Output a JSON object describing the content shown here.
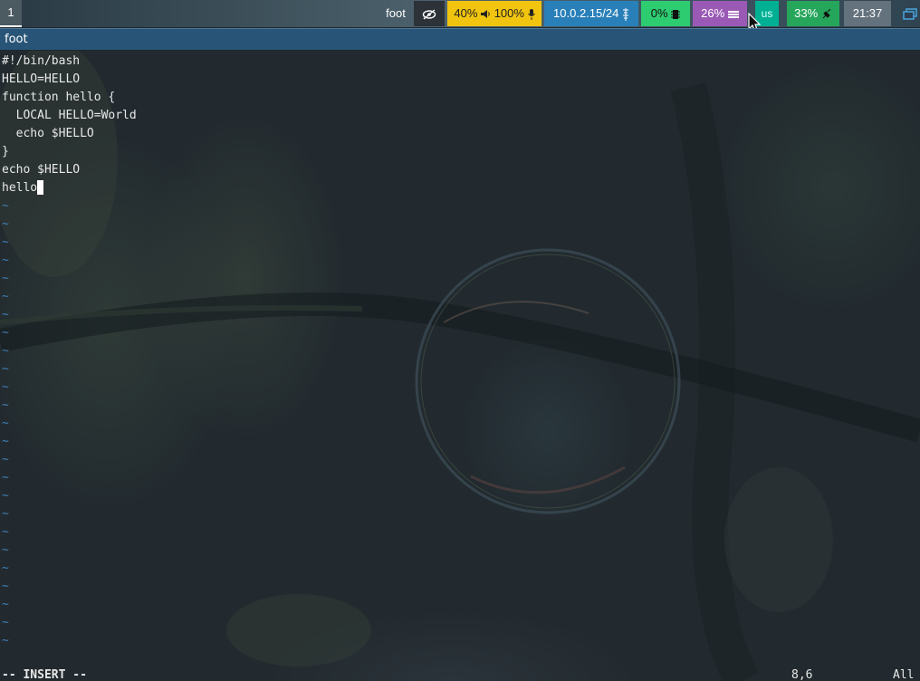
{
  "topbar": {
    "workspace": "1",
    "window_title": "foot",
    "idle_icon": "eye-slash-icon",
    "audio": {
      "volume": "40%",
      "volume_icon": "speaker-icon",
      "mic": "100%",
      "mic_icon": "microphone-icon"
    },
    "network": {
      "ip": "10.0.2.15/24",
      "icon": "ethernet-icon"
    },
    "cpu": {
      "value": "0%",
      "icon": "chip-icon"
    },
    "memory": {
      "value": "26%",
      "icon": "memory-icon"
    },
    "language": "us",
    "battery": {
      "value": "33%",
      "icon": "plug-icon"
    },
    "clock": "21:37",
    "tray_icon": "window-icon"
  },
  "window": {
    "title": "foot"
  },
  "editor": {
    "lines": [
      "#!/bin/bash",
      "HELLO=HELLO",
      "function hello {",
      "  LOCAL HELLO=World",
      "  echo $HELLO",
      "}",
      "echo $HELLO",
      "hello"
    ],
    "tilde": "~",
    "mode": "-- INSERT --",
    "position": "8,6",
    "scroll": "All"
  },
  "colors": {
    "audio_bg": "#f1c40f",
    "network_bg": "#2980b9",
    "cpu_bg": "#2ecc71",
    "memory_bg": "#9b59b6",
    "language_bg": "#00b093",
    "battery_bg": "#26a65b",
    "clock_bg": "#64727d",
    "title_bg": "#285577"
  }
}
